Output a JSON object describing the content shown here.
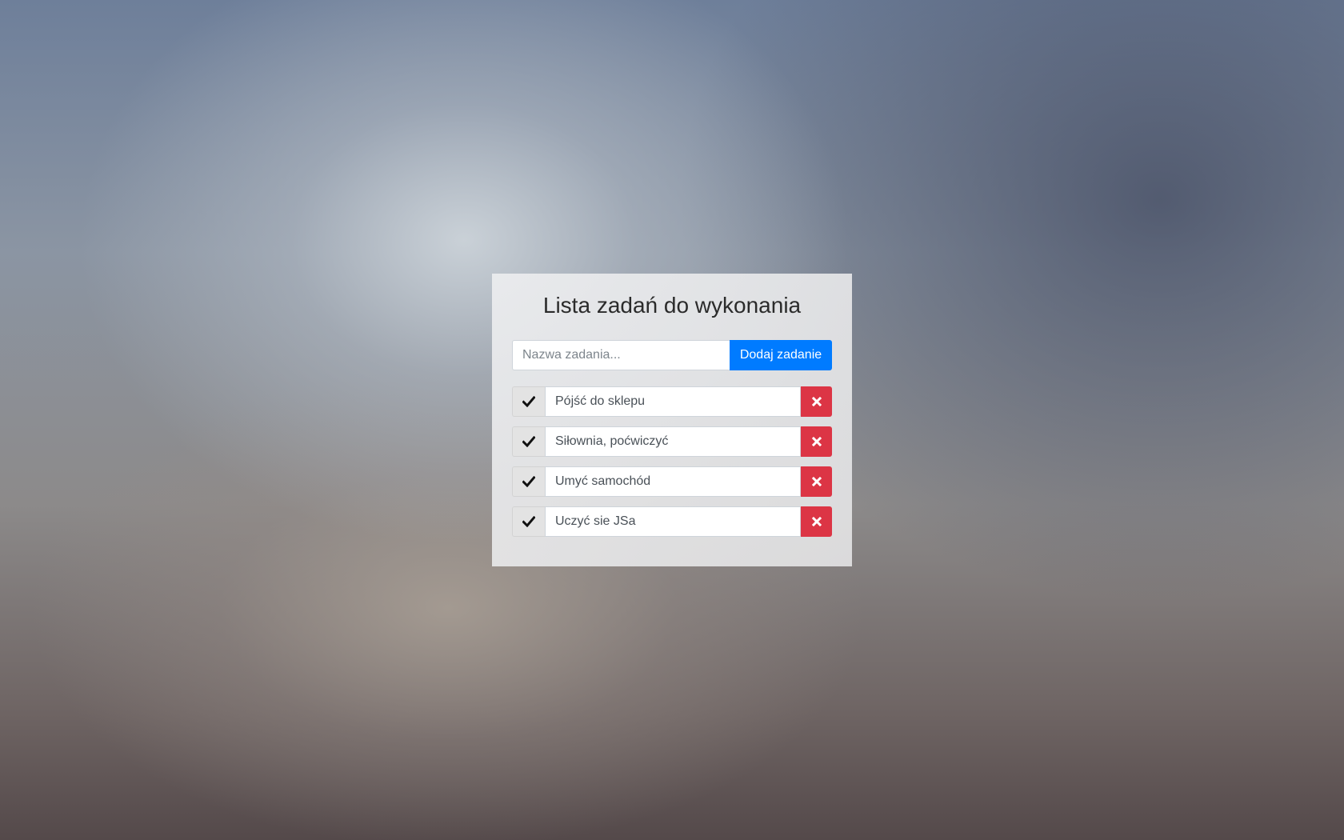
{
  "title": "Lista zadań do wykonania",
  "add_form": {
    "input_placeholder": "Nazwa zadania...",
    "input_value": "",
    "button_label": "Dodaj zadanie"
  },
  "tasks": [
    {
      "name": "Pójść do sklepu",
      "done_icon": "check-icon",
      "delete_icon": "close-icon"
    },
    {
      "name": "Siłownia, poćwiczyć",
      "done_icon": "check-icon",
      "delete_icon": "close-icon"
    },
    {
      "name": "Umyć samochód",
      "done_icon": "check-icon",
      "delete_icon": "close-icon"
    },
    {
      "name": "Uczyć sie JSa",
      "done_icon": "check-icon",
      "delete_icon": "close-icon"
    }
  ],
  "colors": {
    "primary": "#007bff",
    "danger": "#dc3545",
    "check_bg": "#e3e3e3"
  }
}
